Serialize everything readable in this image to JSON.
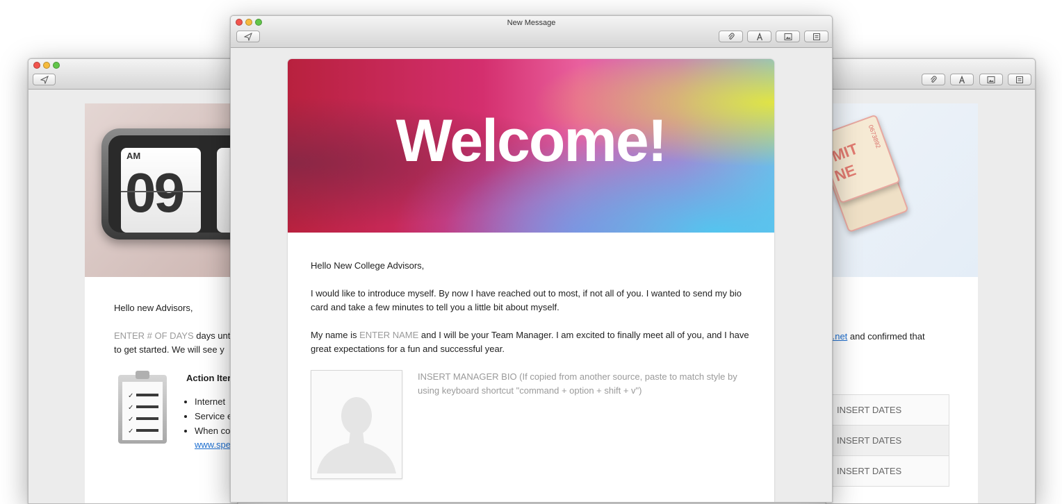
{
  "left_window": {
    "greeting": "Hello new Advisors,",
    "days_placeholder": "ENTER # OF DAYS",
    "days_text": " days unti",
    "line2": "to get started. We will see y",
    "clock": {
      "ampm": "AM",
      "digits": "09"
    },
    "action_title": "Action Iter",
    "list": [
      "Internet",
      "Service e",
      "When co"
    ],
    "link": "www.spe"
  },
  "right_window": {
    "link": "t.net",
    "text": " and confirmed that",
    "dates": [
      "INSERT DATES",
      "INSERT DATES",
      "INSERT DATES"
    ],
    "ticket": {
      "word1": "MIT",
      "word2": "NE",
      "serial1": "0673892",
      "serial2": "892"
    }
  },
  "main_window": {
    "title": "New Message",
    "banner": "Welcome!",
    "greeting": "Hello New College Advisors,",
    "para1": "I would like to introduce myself. By now I have reached out to most, if not all of you. I wanted to send my bio card and take a few minutes to tell you a little bit about myself.",
    "para2_start": "My name is ",
    "para2_placeholder": "ENTER NAME",
    "para2_end": " and I will be your Team Manager. I am excited to finally meet all of you, and I have great expectations for a fun and successful year.",
    "bio_placeholder": "INSERT MANAGER BIO (If copied from another source, paste to match style by using keyboard shortcut \"command + option + shift + v\")"
  },
  "toolbar_icons": [
    "send-icon",
    "attachment-icon",
    "font-icon",
    "photo-icon",
    "template-icon"
  ],
  "colors": {
    "link": "#1d6fd1",
    "placeholder": "#9a9a9a",
    "close": "#f2544d",
    "minimize": "#f6bb3d",
    "zoom": "#62c64a"
  }
}
